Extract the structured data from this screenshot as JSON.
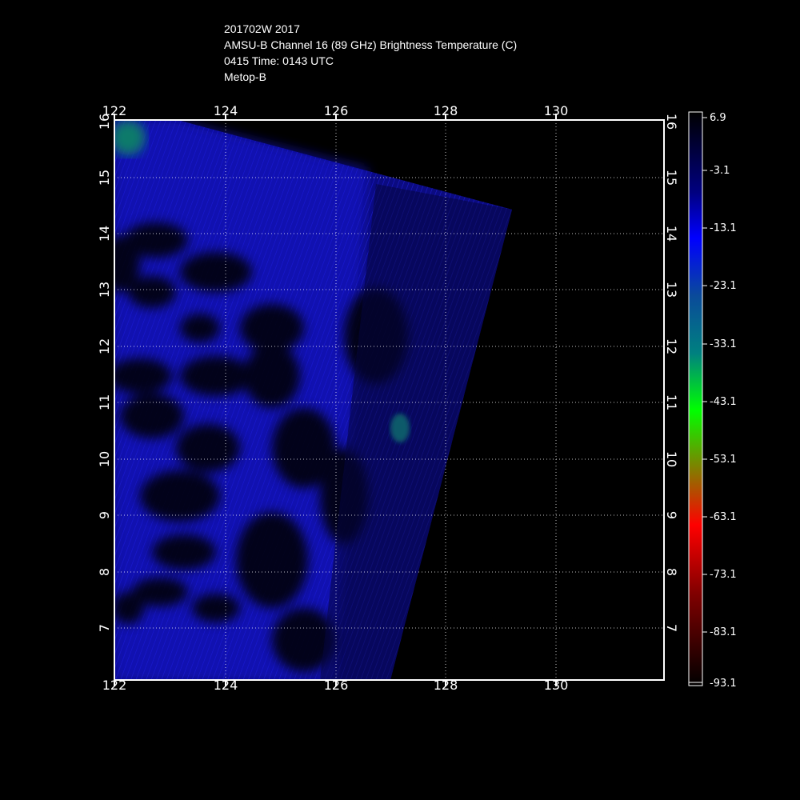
{
  "title": {
    "line1": "201702W 2017",
    "line2": "AMSU-B Channel 16 (89 GHz) Brightness Temperature (C)",
    "line3": "0415 Time: 0143 UTC",
    "line4": "Metop-B"
  },
  "map": {
    "lon_ticks": [
      "122",
      "124",
      "126",
      "128",
      "130"
    ],
    "lat_ticks": [
      "16",
      "15",
      "14",
      "13",
      "12",
      "11",
      "10",
      "9",
      "8",
      "7"
    ],
    "lon_range": [
      122,
      132
    ],
    "lat_range": [
      6,
      16
    ],
    "gridlines": true
  },
  "colorbar": {
    "labels": [
      "6.9",
      "-3.1",
      "-13.1",
      "-23.1",
      "-33.1",
      "-43.1",
      "-53.1",
      "-63.1",
      "-73.1",
      "-83.1",
      "-93.1"
    ],
    "colors": [
      "#000000",
      "#000080",
      "#0000ff",
      "#008080",
      "#00ff00",
      "#808000",
      "#ff0000",
      "#800000",
      "#000000"
    ]
  }
}
